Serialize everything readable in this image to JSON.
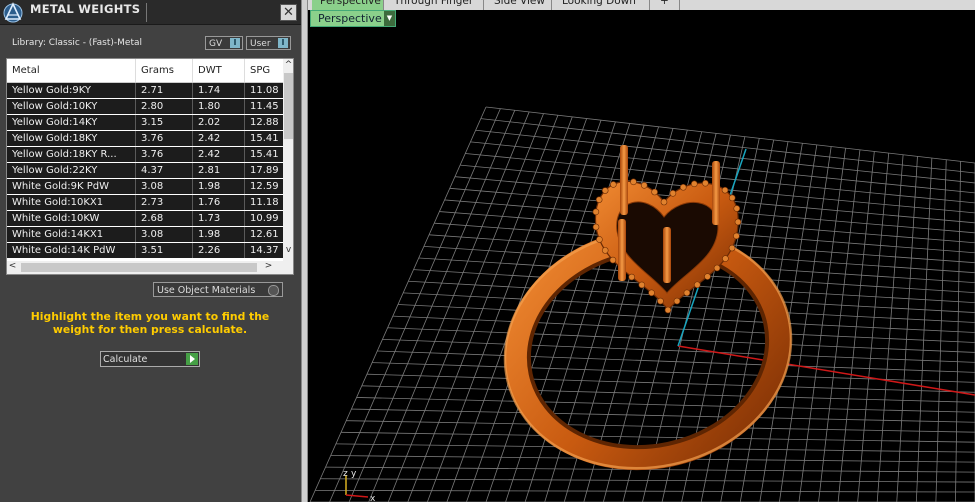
{
  "panel": {
    "title": "METAL WEIGHTS",
    "close_label": "✕",
    "library_label": "Library: Classic - (Fast)-Metal",
    "gv_label": "GV",
    "user_label": "User",
    "toggle_icon": "I",
    "use_object_materials": "Use Object Materials",
    "hint": "Highlight the item you want to find the weight for then press calculate.",
    "calculate_label": "Calculate",
    "accent_color": "#ffcc00"
  },
  "table": {
    "columns": [
      "Metal",
      "Grams",
      "DWT",
      "SPG"
    ],
    "rows": [
      [
        "Yellow Gold:9KY",
        "2.71",
        "1.74",
        "11.08"
      ],
      [
        "Yellow Gold:10KY",
        "2.80",
        "1.80",
        "11.45"
      ],
      [
        "Yellow Gold:14KY",
        "3.15",
        "2.02",
        "12.88"
      ],
      [
        "Yellow Gold:18KY",
        "3.76",
        "2.42",
        "15.41"
      ],
      [
        "Yellow Gold:18KY R...",
        "3.76",
        "2.42",
        "15.41"
      ],
      [
        "Yellow Gold:22KY",
        "4.37",
        "2.81",
        "17.89"
      ],
      [
        "White Gold:9K PdW",
        "3.08",
        "1.98",
        "12.59"
      ],
      [
        "White Gold:10KX1",
        "2.73",
        "1.76",
        "11.18"
      ],
      [
        "White Gold:10KW",
        "2.68",
        "1.73",
        "10.99"
      ],
      [
        "White Gold:14KX1",
        "3.08",
        "1.98",
        "12.61"
      ],
      [
        "White Gold:14K PdW",
        "3.51",
        "2.26",
        "14.37"
      ]
    ]
  },
  "viewport": {
    "tabs": [
      "Perspective",
      "Through Finger",
      "Side View",
      "Looking Down",
      "+"
    ],
    "view_dropdown": "Perspective",
    "axis_labels": [
      "z",
      "y",
      "x"
    ],
    "colors": {
      "grid": "#7a7a7a",
      "x_axis": "#d01818",
      "y_axis": "#18a6c0",
      "model": "#d86a18"
    }
  }
}
